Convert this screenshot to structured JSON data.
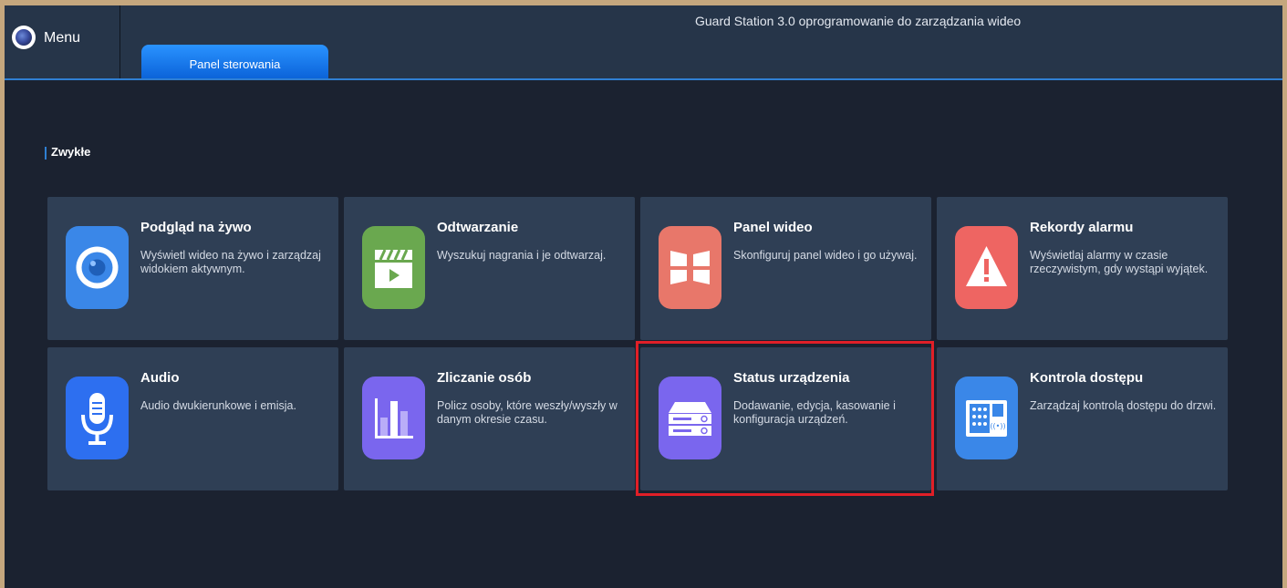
{
  "header": {
    "menu_label": "Menu",
    "app_title": "Guard Station 3.0 oprogramowanie do zarządzania wideo",
    "tabs": [
      {
        "label": "Panel sterowania",
        "active": true
      }
    ]
  },
  "section": {
    "title": "Zwykłe"
  },
  "tiles": [
    {
      "title": "Podgląd na żywo",
      "desc": "Wyświetl wideo na żywo i zarządzaj widokiem aktywnym.",
      "icon": "live-view-icon",
      "color": "#3a87e8"
    },
    {
      "title": "Odtwarzanie",
      "desc": "Wyszukuj nagrania i je odtwarzaj.",
      "icon": "playback-icon",
      "color": "#6aa84f"
    },
    {
      "title": "Panel wideo",
      "desc": "Skonfiguruj panel wideo i go używaj.",
      "icon": "video-wall-icon",
      "color": "#e8776a"
    },
    {
      "title": "Rekordy alarmu",
      "desc": "Wyświetlaj alarmy w czasie rzeczywistym, gdy wystąpi wyjątek.",
      "icon": "alarm-icon",
      "color": "#ee6562"
    },
    {
      "title": "Audio",
      "desc": "Audio dwukierunkowe i emisja.",
      "icon": "microphone-icon",
      "color": "#2d6ff0"
    },
    {
      "title": "Zliczanie osób",
      "desc": "Policz osoby, które weszły/wyszły w danym okresie czasu.",
      "icon": "people-counting-icon",
      "color": "#7a66ee"
    },
    {
      "title": "Status urządzenia",
      "desc": "Dodawanie, edycja, kasowanie i konfiguracja urządzeń.",
      "icon": "device-status-icon",
      "color": "#7a66ee",
      "highlighted": true
    },
    {
      "title": "Kontrola dostępu",
      "desc": "Zarządzaj kontrolą dostępu do drzwi.",
      "icon": "access-control-icon",
      "color": "#3a87e8"
    }
  ],
  "colors": {
    "accent": "#2f7fd3",
    "highlight": "#e01f27",
    "card_bg": "#2f3f55",
    "background": "#1b2230"
  }
}
